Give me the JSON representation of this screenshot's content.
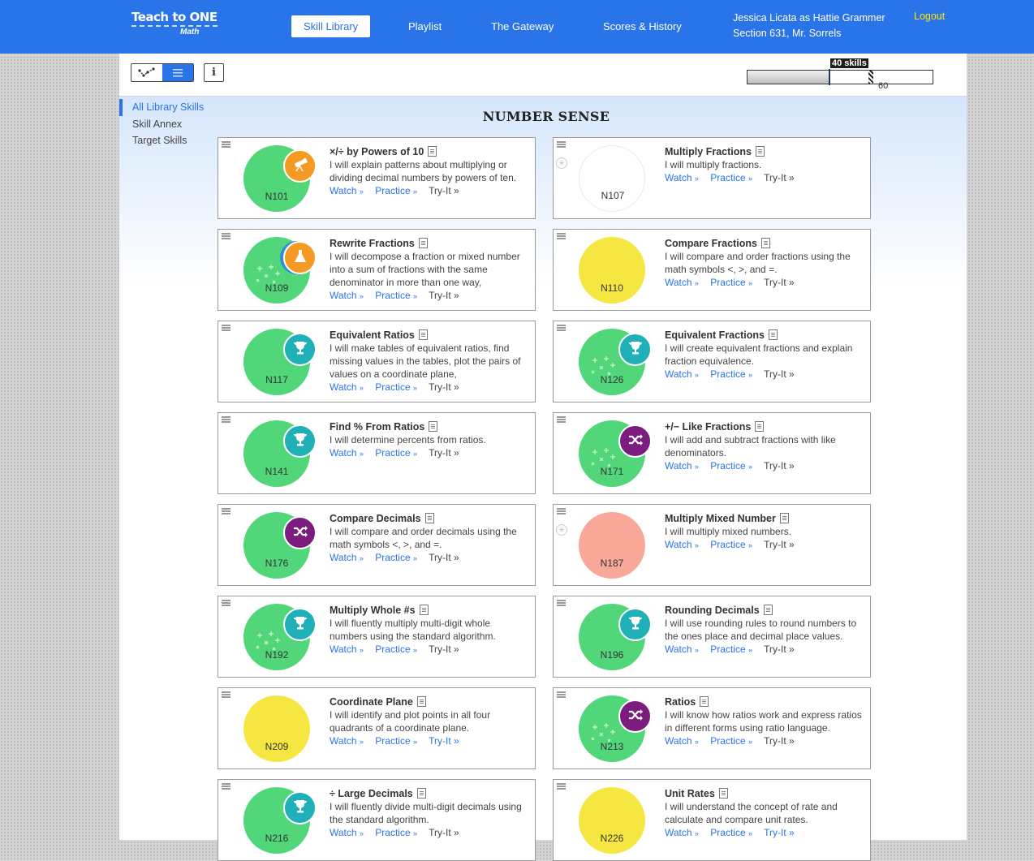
{
  "logo": {
    "line1": "Teach to ONE",
    "line2": "Math"
  },
  "nav": [
    {
      "label": "Skill Library",
      "active": true
    },
    {
      "label": "Playlist",
      "active": false
    },
    {
      "label": "The Gateway",
      "active": false
    },
    {
      "label": "Scores & History",
      "active": false
    }
  ],
  "user": {
    "name": "Jessica Licata as Hattie Grammer",
    "section": "Section 631, Mr. Sorrels",
    "logout": "Logout"
  },
  "progress": {
    "label": "40 skills",
    "goal": "60",
    "current_value": 40,
    "goal_value": 60
  },
  "sidebar": {
    "items": [
      "All Library Skills",
      "Skill Annex",
      "Target Skills"
    ]
  },
  "section_title": "NUMBER SENSE",
  "link_labels": {
    "watch": "Watch",
    "practice": "Practice",
    "tryit": "Try-It",
    "arrow": "»"
  },
  "colors": {
    "brand_blue": "#2a74ea",
    "logout_yellow": "#ffe600",
    "green": "#52d67a",
    "yellow": "#f5e642",
    "salmon": "#f7a898",
    "teal": "#1fb0b8",
    "purple": "#7b1c7e",
    "orange": "#f59a23"
  },
  "skills": [
    {
      "code": "N101",
      "title": "×/÷ by Powers of 10",
      "desc": "I will explain patterns about multiplying or dividing decimal numbers by powers of ten.",
      "color": "green",
      "badge": "telescope-icon",
      "badge_color": "orange",
      "sparkles": false,
      "star": false,
      "tryit_link": false
    },
    {
      "code": "N107",
      "title": "Multiply Fractions",
      "desc": "I will multiply fractions.",
      "color": "white",
      "badge": "",
      "badge_color": "",
      "sparkles": false,
      "star": true,
      "tryit_link": false
    },
    {
      "code": "N109",
      "title": "Rewrite Fractions",
      "desc": "I will decompose a fraction or mixed number into a sum of fractions with the same denominator in more than one way,",
      "color": "green",
      "badge": "flask-icon",
      "badge_color": "orange",
      "sparkles": true,
      "star": false,
      "tryit_link": false
    },
    {
      "code": "N110",
      "title": "Compare Fractions",
      "desc": "I will compare and order fractions using the math symbols <, >, and =.",
      "color": "yellow",
      "badge": "",
      "badge_color": "",
      "sparkles": false,
      "star": false,
      "tryit_link": false
    },
    {
      "code": "N117",
      "title": "Equivalent Ratios",
      "desc": "I will make tables of equivalent ratios, find missing values in the tables, plot the pairs of values on a coordinate plane,",
      "color": "green",
      "badge": "trophy-icon",
      "badge_color": "teal",
      "sparkles": false,
      "star": false,
      "tryit_link": false
    },
    {
      "code": "N126",
      "title": "Equivalent Fractions",
      "desc": "I will create equivalent fractions and explain fraction equivalence.",
      "color": "green",
      "badge": "trophy-icon",
      "badge_color": "teal",
      "sparkles": true,
      "star": false,
      "tryit_link": false
    },
    {
      "code": "N141",
      "title": "Find % From Ratios",
      "desc": "I will determine percents from ratios.",
      "color": "green",
      "badge": "trophy-icon",
      "badge_color": "teal",
      "sparkles": false,
      "star": false,
      "tryit_link": false
    },
    {
      "code": "N171",
      "title": "+/− Like Fractions",
      "desc": "I will add and subtract fractions with like denominators.",
      "color": "green",
      "badge": "shuffle-icon",
      "badge_color": "purple",
      "sparkles": true,
      "star": false,
      "tryit_link": false
    },
    {
      "code": "N176",
      "title": "Compare Decimals",
      "desc": "I will compare and order decimals using the math symbols <, >, and =.",
      "color": "green",
      "badge": "shuffle-icon",
      "badge_color": "purple",
      "sparkles": false,
      "star": false,
      "tryit_link": false
    },
    {
      "code": "N187",
      "title": "Multiply Mixed Number",
      "desc": "I will multiply mixed numbers.",
      "color": "salmon",
      "badge": "",
      "badge_color": "",
      "sparkles": false,
      "star": true,
      "tryit_link": false
    },
    {
      "code": "N192",
      "title": "Multiply Whole #s",
      "desc": "I will fluently multiply multi-digit whole numbers using the standard algorithm.",
      "color": "green",
      "badge": "trophy-icon",
      "badge_color": "teal",
      "sparkles": true,
      "star": false,
      "tryit_link": false
    },
    {
      "code": "N196",
      "title": "Rounding Decimals",
      "desc": "I will use rounding rules to round numbers to the ones place and decimal place values.",
      "color": "green",
      "badge": "trophy-icon",
      "badge_color": "teal",
      "sparkles": false,
      "star": false,
      "tryit_link": false
    },
    {
      "code": "N209",
      "title": "Coordinate Plane",
      "desc": "I will identify and plot points in all four quadrants of a coordinate plane.",
      "color": "yellow",
      "badge": "",
      "badge_color": "",
      "sparkles": false,
      "star": false,
      "tryit_link": true
    },
    {
      "code": "N213",
      "title": "Ratios",
      "desc": "I will know how ratios work and express ratios in different forms using ratio language.",
      "color": "green",
      "badge": "shuffle-icon",
      "badge_color": "purple",
      "sparkles": true,
      "star": false,
      "tryit_link": false
    },
    {
      "code": "N216",
      "title": "÷ Large Decimals",
      "desc": "I will fluently divide multi-digit decimals using the standard algorithm.",
      "color": "green",
      "badge": "trophy-icon",
      "badge_color": "teal",
      "sparkles": false,
      "star": false,
      "tryit_link": false
    },
    {
      "code": "N226",
      "title": "Unit Rates",
      "desc": "I will understand the concept of rate and calculate and compare unit rates.",
      "color": "yellow",
      "badge": "",
      "badge_color": "",
      "sparkles": false,
      "star": false,
      "tryit_link": true
    }
  ]
}
